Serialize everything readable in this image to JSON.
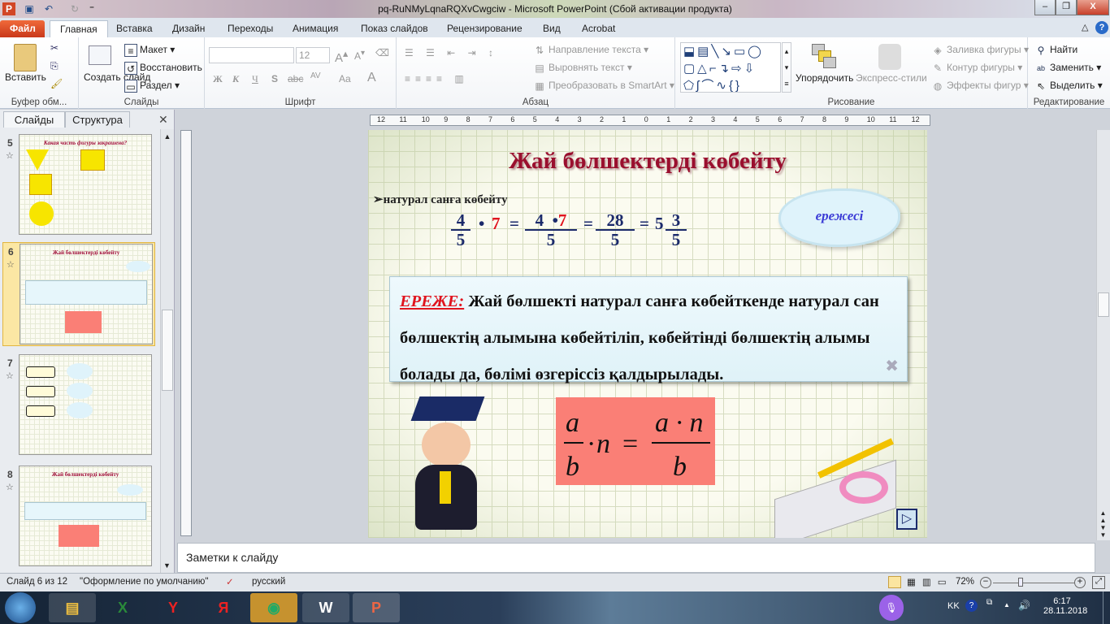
{
  "window": {
    "title": "pq-RuNMyLqnaRQXvCwgciw  -  Microsoft PowerPoint (Сбой активации продукта)",
    "app_icon": "P"
  },
  "quick_access": [
    "save-icon",
    "undo-icon",
    "redo-icon",
    "customize-icon"
  ],
  "tabs": [
    "Файл",
    "Главная",
    "Вставка",
    "Дизайн",
    "Переходы",
    "Анимация",
    "Показ слайдов",
    "Рецензирование",
    "Вид",
    "Acrobat"
  ],
  "ribbon": {
    "clipboard": {
      "paste": "Вставить",
      "label": "Буфер обм..."
    },
    "slides": {
      "new_slide": "Создать слайд",
      "layout": "Макет",
      "reset": "Восстановить",
      "section": "Раздел",
      "label": "Слайды"
    },
    "font": {
      "size": "12",
      "bold": "Ж",
      "italic": "К",
      "underline": "Ч",
      "shadow": "S",
      "strike": "abc",
      "spacing": "AV",
      "case": "Aa",
      "color": "A",
      "label": "Шрифт"
    },
    "paragraph": {
      "text_direction": "Направление текста",
      "align_text": "Выровнять текст",
      "smartart": "Преобразовать в SmartArt",
      "label": "Абзац"
    },
    "drawing": {
      "arrange": "Упорядочить",
      "quick_styles": "Экспресс-стили",
      "fill": "Заливка фигуры",
      "outline": "Контур фигуры",
      "effects": "Эффекты фигур",
      "label": "Рисование"
    },
    "editing": {
      "find": "Найти",
      "replace": "Заменить",
      "select": "Выделить",
      "label": "Редактирование"
    }
  },
  "panel": {
    "tabs": [
      "Слайды",
      "Структура"
    ],
    "thumbnails": [
      {
        "num": "5",
        "title": "Какая часть фигуры закрашена?"
      },
      {
        "num": "6",
        "title": "Жай бөлшектерді көбейту",
        "selected": true
      },
      {
        "num": "7",
        "title": ""
      },
      {
        "num": "8",
        "title": "Жай бөлшектерді көбейту"
      }
    ]
  },
  "ruler": [
    "12",
    "11",
    "10",
    "9",
    "8",
    "7",
    "6",
    "5",
    "4",
    "3",
    "2",
    "1",
    "0",
    "1",
    "2",
    "3",
    "4",
    "5",
    "6",
    "7",
    "8",
    "9",
    "10",
    "11",
    "12"
  ],
  "slide": {
    "title": "Жай бөлшектерді көбейту",
    "bullet": "натурал  санға көбейту",
    "example": {
      "f1_num": "4",
      "f1_den": "5",
      "dot": "•",
      "mult": "7",
      "eq": "=",
      "f2_num_a": "4",
      "f2_num_b": "7",
      "f2_den": "5",
      "f3_num": "28",
      "f3_den": "5",
      "whole": "5",
      "f4_num": "3",
      "f4_den": "5"
    },
    "cloud": "ережесі",
    "rule_label": "ЕРЕЖЕ:",
    "rule_text": " Жай бөлшекті натурал санға көбейткенде натурал сан бөлшектің алымына көбейтіліп, көбейтінді бөлшектің алымы болады да, бөлімі өзгеріссіз қалдырылады.",
    "formula": {
      "a": "a",
      "b": "b",
      "n": "n",
      "rhs_num": "a · n",
      "rhs_den": "b",
      "dot": "·",
      "eq": "="
    },
    "nav_button": "▷"
  },
  "notes_placeholder": "Заметки к слайду",
  "status": {
    "slide": "Слайд 6 из 12",
    "theme": "\"Оформление по умолчанию\"",
    "language": "русский",
    "zoom": "72%",
    "zoom_value": 72
  },
  "taskbar": {
    "apps": [
      "explorer",
      "excel",
      "yandex-browser",
      "yandex",
      "chrome",
      "word",
      "powerpoint"
    ],
    "lang": "KK",
    "time": "6:17",
    "date": "28.11.2018"
  }
}
